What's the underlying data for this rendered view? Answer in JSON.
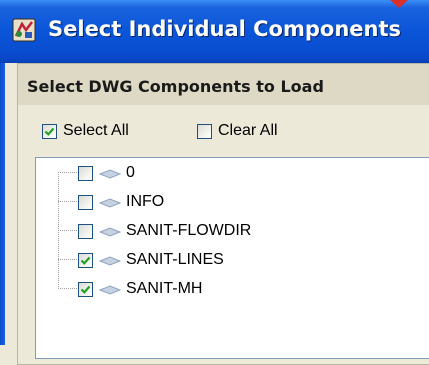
{
  "window": {
    "title": "Select Individual Components",
    "app_icon": "cad-app-icon",
    "accent_color": "#0a55d8"
  },
  "group": {
    "title": "Select DWG Components to Load"
  },
  "actions": {
    "select_all_label": "Select All",
    "select_all_checked": true,
    "clear_all_label": "Clear All",
    "clear_all_checked": false
  },
  "tree": {
    "items": [
      {
        "label": "0",
        "checked": false,
        "icon": "layer-icon"
      },
      {
        "label": "INFO",
        "checked": false,
        "icon": "layer-icon"
      },
      {
        "label": "SANIT-FLOWDIR",
        "checked": false,
        "icon": "layer-icon"
      },
      {
        "label": "SANIT-LINES",
        "checked": true,
        "icon": "layer-icon"
      },
      {
        "label": "SANIT-MH",
        "checked": true,
        "icon": "layer-icon"
      }
    ]
  }
}
